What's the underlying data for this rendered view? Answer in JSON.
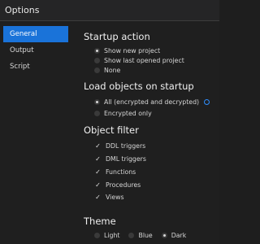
{
  "window": {
    "title": "Options"
  },
  "sidebar": {
    "items": [
      {
        "label": "General",
        "active": true
      },
      {
        "label": "Output",
        "active": false
      },
      {
        "label": "Script",
        "active": false
      }
    ]
  },
  "startup": {
    "title": "Startup action",
    "options": [
      {
        "label": "Show new project",
        "selected": true
      },
      {
        "label": "Show last opened project",
        "selected": false
      },
      {
        "label": "None",
        "selected": false
      }
    ]
  },
  "load_objects": {
    "title": "Load objects on startup",
    "options": [
      {
        "label": "All (encrypted and decrypted)",
        "selected": true
      },
      {
        "label": "Encrypted only",
        "selected": false
      }
    ],
    "info_icon": "info-circle-icon"
  },
  "object_filter": {
    "title": "Object filter",
    "items": [
      {
        "label": "DDL triggers",
        "checked": true
      },
      {
        "label": "DML triggers",
        "checked": true
      },
      {
        "label": "Functions",
        "checked": true
      },
      {
        "label": "Procedures",
        "checked": true
      },
      {
        "label": "Views",
        "checked": true
      }
    ]
  },
  "theme": {
    "title": "Theme",
    "options": [
      {
        "label": "Light",
        "selected": false
      },
      {
        "label": "Blue",
        "selected": false
      },
      {
        "label": "Dark",
        "selected": true
      }
    ]
  },
  "colors": {
    "accent": "#1a73d9",
    "background": "#1f1f1f",
    "info_icon": "#2f8fff"
  }
}
